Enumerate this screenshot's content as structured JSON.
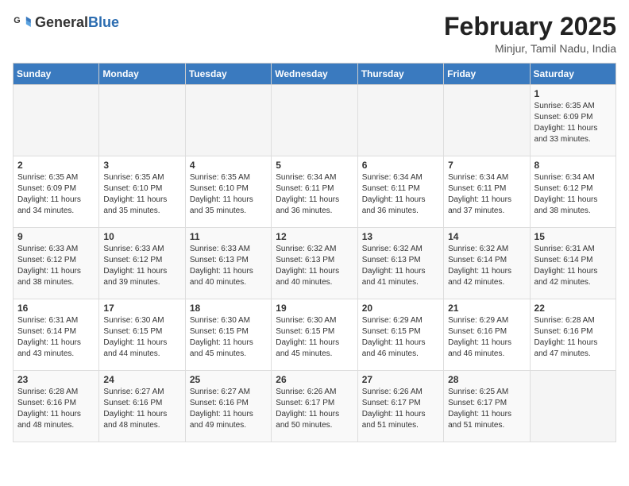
{
  "header": {
    "logo": {
      "general": "General",
      "blue": "Blue"
    },
    "title": "February 2025",
    "location": "Minjur, Tamil Nadu, India"
  },
  "calendar": {
    "days_of_week": [
      "Sunday",
      "Monday",
      "Tuesday",
      "Wednesday",
      "Thursday",
      "Friday",
      "Saturday"
    ],
    "weeks": [
      [
        {
          "day": "",
          "info": ""
        },
        {
          "day": "",
          "info": ""
        },
        {
          "day": "",
          "info": ""
        },
        {
          "day": "",
          "info": ""
        },
        {
          "day": "",
          "info": ""
        },
        {
          "day": "",
          "info": ""
        },
        {
          "day": "1",
          "info": "Sunrise: 6:35 AM\nSunset: 6:09 PM\nDaylight: 11 hours\nand 33 minutes."
        }
      ],
      [
        {
          "day": "2",
          "info": "Sunrise: 6:35 AM\nSunset: 6:09 PM\nDaylight: 11 hours\nand 34 minutes."
        },
        {
          "day": "3",
          "info": "Sunrise: 6:35 AM\nSunset: 6:10 PM\nDaylight: 11 hours\nand 35 minutes."
        },
        {
          "day": "4",
          "info": "Sunrise: 6:35 AM\nSunset: 6:10 PM\nDaylight: 11 hours\nand 35 minutes."
        },
        {
          "day": "5",
          "info": "Sunrise: 6:34 AM\nSunset: 6:11 PM\nDaylight: 11 hours\nand 36 minutes."
        },
        {
          "day": "6",
          "info": "Sunrise: 6:34 AM\nSunset: 6:11 PM\nDaylight: 11 hours\nand 36 minutes."
        },
        {
          "day": "7",
          "info": "Sunrise: 6:34 AM\nSunset: 6:11 PM\nDaylight: 11 hours\nand 37 minutes."
        },
        {
          "day": "8",
          "info": "Sunrise: 6:34 AM\nSunset: 6:12 PM\nDaylight: 11 hours\nand 38 minutes."
        }
      ],
      [
        {
          "day": "9",
          "info": "Sunrise: 6:33 AM\nSunset: 6:12 PM\nDaylight: 11 hours\nand 38 minutes."
        },
        {
          "day": "10",
          "info": "Sunrise: 6:33 AM\nSunset: 6:12 PM\nDaylight: 11 hours\nand 39 minutes."
        },
        {
          "day": "11",
          "info": "Sunrise: 6:33 AM\nSunset: 6:13 PM\nDaylight: 11 hours\nand 40 minutes."
        },
        {
          "day": "12",
          "info": "Sunrise: 6:32 AM\nSunset: 6:13 PM\nDaylight: 11 hours\nand 40 minutes."
        },
        {
          "day": "13",
          "info": "Sunrise: 6:32 AM\nSunset: 6:13 PM\nDaylight: 11 hours\nand 41 minutes."
        },
        {
          "day": "14",
          "info": "Sunrise: 6:32 AM\nSunset: 6:14 PM\nDaylight: 11 hours\nand 42 minutes."
        },
        {
          "day": "15",
          "info": "Sunrise: 6:31 AM\nSunset: 6:14 PM\nDaylight: 11 hours\nand 42 minutes."
        }
      ],
      [
        {
          "day": "16",
          "info": "Sunrise: 6:31 AM\nSunset: 6:14 PM\nDaylight: 11 hours\nand 43 minutes."
        },
        {
          "day": "17",
          "info": "Sunrise: 6:30 AM\nSunset: 6:15 PM\nDaylight: 11 hours\nand 44 minutes."
        },
        {
          "day": "18",
          "info": "Sunrise: 6:30 AM\nSunset: 6:15 PM\nDaylight: 11 hours\nand 45 minutes."
        },
        {
          "day": "19",
          "info": "Sunrise: 6:30 AM\nSunset: 6:15 PM\nDaylight: 11 hours\nand 45 minutes."
        },
        {
          "day": "20",
          "info": "Sunrise: 6:29 AM\nSunset: 6:15 PM\nDaylight: 11 hours\nand 46 minutes."
        },
        {
          "day": "21",
          "info": "Sunrise: 6:29 AM\nSunset: 6:16 PM\nDaylight: 11 hours\nand 46 minutes."
        },
        {
          "day": "22",
          "info": "Sunrise: 6:28 AM\nSunset: 6:16 PM\nDaylight: 11 hours\nand 47 minutes."
        }
      ],
      [
        {
          "day": "23",
          "info": "Sunrise: 6:28 AM\nSunset: 6:16 PM\nDaylight: 11 hours\nand 48 minutes."
        },
        {
          "day": "24",
          "info": "Sunrise: 6:27 AM\nSunset: 6:16 PM\nDaylight: 11 hours\nand 48 minutes."
        },
        {
          "day": "25",
          "info": "Sunrise: 6:27 AM\nSunset: 6:16 PM\nDaylight: 11 hours\nand 49 minutes."
        },
        {
          "day": "26",
          "info": "Sunrise: 6:26 AM\nSunset: 6:17 PM\nDaylight: 11 hours\nand 50 minutes."
        },
        {
          "day": "27",
          "info": "Sunrise: 6:26 AM\nSunset: 6:17 PM\nDaylight: 11 hours\nand 51 minutes."
        },
        {
          "day": "28",
          "info": "Sunrise: 6:25 AM\nSunset: 6:17 PM\nDaylight: 11 hours\nand 51 minutes."
        },
        {
          "day": "",
          "info": ""
        }
      ]
    ]
  }
}
